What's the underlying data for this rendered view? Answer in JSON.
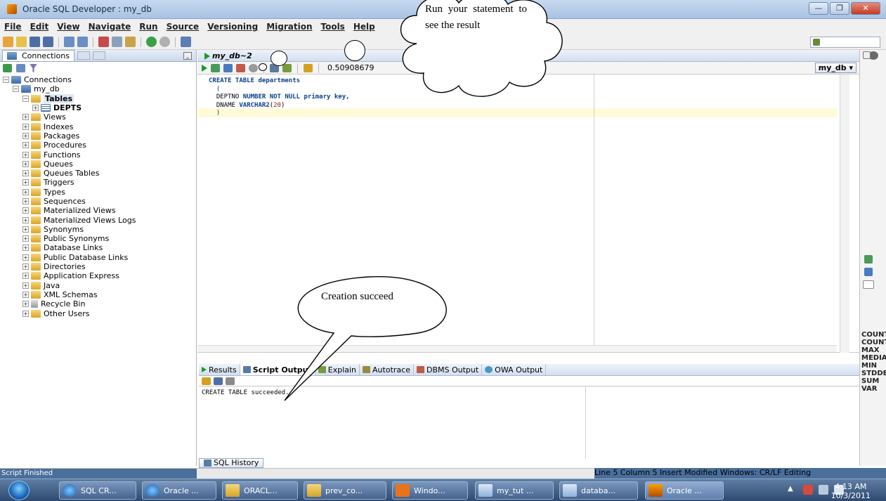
{
  "window": {
    "title": "Oracle SQL Developer : my_db"
  },
  "menu": [
    "File",
    "Edit",
    "View",
    "Navigate",
    "Run",
    "Source",
    "Versioning",
    "Migration",
    "Tools",
    "Help"
  ],
  "connections_panel": {
    "tab_label": "Connections",
    "tree": [
      {
        "label": "Connections",
        "level": 0,
        "icon": "db-icon"
      },
      {
        "label": "my_db",
        "level": 1,
        "icon": "db-icon"
      },
      {
        "label": "Tables",
        "level": 2,
        "icon": "folder-icon",
        "selected": true
      },
      {
        "label": "DEPTS",
        "level": 3,
        "icon": "table-icon"
      },
      {
        "label": "Views",
        "level": 2,
        "icon": "folder-icon"
      },
      {
        "label": "Indexes",
        "level": 2,
        "icon": "folder-icon"
      },
      {
        "label": "Packages",
        "level": 2,
        "icon": "folder-icon"
      },
      {
        "label": "Procedures",
        "level": 2,
        "icon": "folder-icon"
      },
      {
        "label": "Functions",
        "level": 2,
        "icon": "folder-icon"
      },
      {
        "label": "Queues",
        "level": 2,
        "icon": "folder-icon"
      },
      {
        "label": "Queues Tables",
        "level": 2,
        "icon": "folder-icon"
      },
      {
        "label": "Triggers",
        "level": 2,
        "icon": "folder-icon"
      },
      {
        "label": "Types",
        "level": 2,
        "icon": "folder-icon"
      },
      {
        "label": "Sequences",
        "level": 2,
        "icon": "folder-icon"
      },
      {
        "label": "Materialized Views",
        "level": 2,
        "icon": "folder-icon"
      },
      {
        "label": "Materialized Views Logs",
        "level": 2,
        "icon": "folder-icon"
      },
      {
        "label": "Synonyms",
        "level": 2,
        "icon": "folder-icon"
      },
      {
        "label": "Public Synonyms",
        "level": 2,
        "icon": "folder-icon"
      },
      {
        "label": "Database Links",
        "level": 2,
        "icon": "folder-icon"
      },
      {
        "label": "Public Database Links",
        "level": 2,
        "icon": "folder-icon"
      },
      {
        "label": "Directories",
        "level": 2,
        "icon": "folder-icon"
      },
      {
        "label": "Application Express",
        "level": 2,
        "icon": "folder-icon"
      },
      {
        "label": "Java",
        "level": 2,
        "icon": "folder-icon"
      },
      {
        "label": "XML Schemas",
        "level": 2,
        "icon": "folder-icon"
      },
      {
        "label": "Recycle Bin",
        "level": 2,
        "icon": "bin-icon"
      },
      {
        "label": "Other Users",
        "level": 2,
        "icon": "folder-icon"
      }
    ]
  },
  "editor": {
    "tab_label": "my_db~2",
    "timing": "0.50908679",
    "connection": "my_db",
    "code_lines": [
      "CREATE TABLE departments",
      "(",
      "DEPTNO NUMBER NOT NULL primary key,",
      "DNAME VARCHAR2(20)",
      ")"
    ]
  },
  "output": {
    "tabs": [
      "Results",
      "Script Output",
      "Explain",
      "Autotrace",
      "DBMS Output",
      "OWA Output"
    ],
    "active_tab": "Script Output",
    "message": "CREATE TABLE succeeded.",
    "history_tab": "SQL History"
  },
  "right_dock": {
    "functions": [
      "COUNT",
      "COUNT",
      "MAX",
      "MEDIAN",
      "MIN",
      "STDDEV",
      "SUM",
      "VAR"
    ]
  },
  "status": {
    "left": "Script Finished",
    "position": "Line 5 Column 5",
    "mode": "Insert",
    "modified": "Modified",
    "line_endings": "Windows: CR/LF Editing"
  },
  "taskbar": {
    "buttons": [
      "SQL CR...",
      "Oracle ...",
      "ORACL...",
      "prev_co...",
      "Windo...",
      "my_tut ...",
      "databa...",
      "Oracle ..."
    ],
    "time": "4:13 AM",
    "date": "10/3/2011"
  },
  "annotations": {
    "cloud_text": "Run your statement to see the result",
    "speech_text": "Creation succeed"
  },
  "colors": {
    "accent": "#1c9a2c",
    "keyword": "#0a3f8c",
    "status_bar": "#4a6f9b"
  }
}
